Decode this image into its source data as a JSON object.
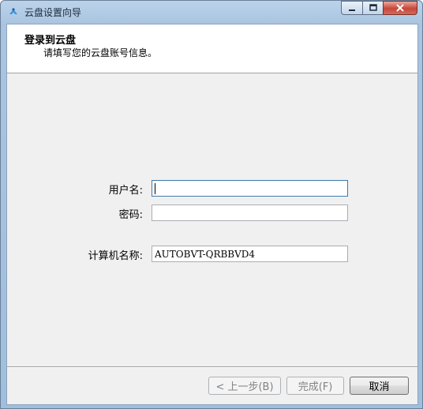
{
  "window": {
    "title": "云盘设置向导"
  },
  "header": {
    "title": "登录到云盘",
    "subtitle": "请填写您的云盘账号信息。"
  },
  "form": {
    "username": {
      "label": "用户名:",
      "value": ""
    },
    "password": {
      "label": "密码:",
      "value": ""
    },
    "computer_name": {
      "label": "计算机名称:",
      "value": "AUTOBVT-QRBBVD4"
    }
  },
  "buttons": {
    "back": "< 上一步(B)",
    "finish": "完成(F)",
    "cancel": "取消"
  },
  "colors": {
    "titlebar": "#a9c4e0",
    "close_button": "#c7463a",
    "dialog_bg": "#f0f0f0"
  }
}
